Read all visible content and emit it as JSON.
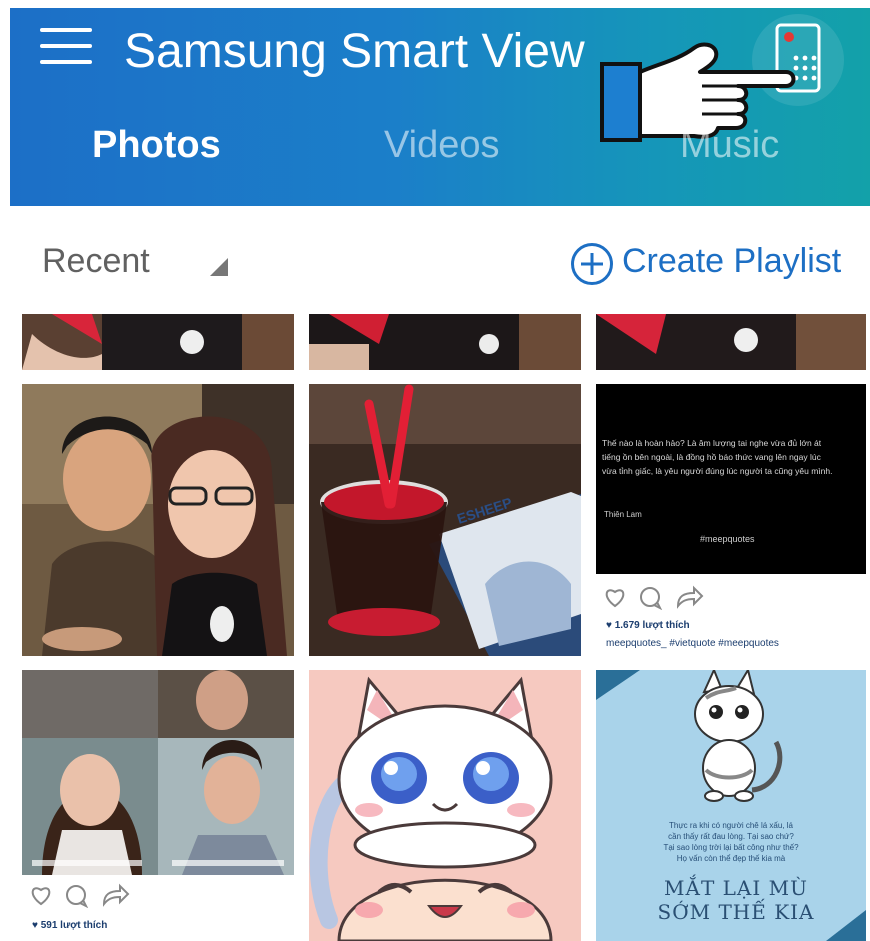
{
  "header": {
    "title": "Samsung Smart View",
    "tabs": [
      {
        "label": "Photos",
        "active": true
      },
      {
        "label": "Videos",
        "active": false
      },
      {
        "label": "Music",
        "active": false
      }
    ]
  },
  "toolbar": {
    "sort_label": "Recent",
    "create_label": "Create Playlist"
  },
  "photos": {
    "quote_tile": {
      "text_lines": [
        "Thế nào là hoàn hảo? Là âm lượng tai nghe vừa đủ lớn át",
        "tiếng ồn bên ngoài, là đồng hồ báo thức vang lên ngay lúc",
        "vừa tỉnh giấc, là yêu người đúng lúc người ta cũng yêu mình."
      ],
      "author": "Thiên Lam",
      "hashtag": "#meepquotes",
      "likes": "♥ 1.679 lượt thích",
      "caption": "meepquotes_ #vietquote #meepquotes"
    },
    "drama_tile": {
      "likes": "♥ 591 lượt thích"
    },
    "cup_tile": {
      "cup_text": "ESHEEP"
    },
    "chi_tile": {
      "text_lines": [
        "Thực ra khi có người chê lá xấu, lá",
        "cần thấy rất đau lòng. Tại sao chứ?",
        "Tại sao lòng trời lại bất công như thế?",
        "Họ vấn còn thể đẹp thế kia mà"
      ],
      "handwriting_line1": "MẮT LẠI MÙ",
      "handwriting_line2": "SỚM THẾ KIA"
    }
  }
}
